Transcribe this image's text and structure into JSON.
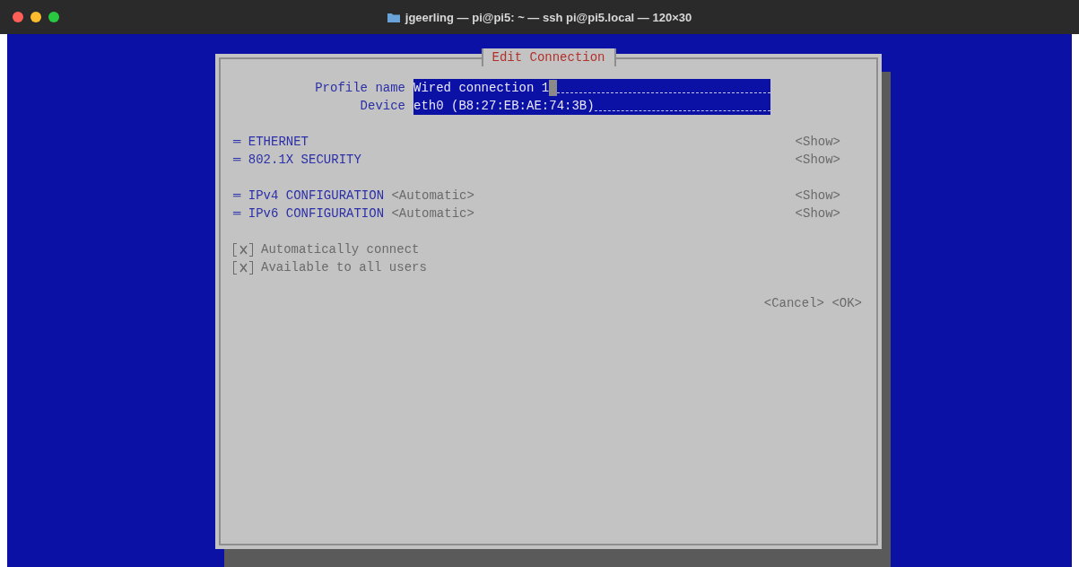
{
  "window": {
    "title": "jgeerling — pi@pi5: ~ — ssh pi@pi5.local — 120×30"
  },
  "dialog": {
    "title": "Edit Connection",
    "fields": [
      {
        "label": "Profile name",
        "value": "Wired connection 1",
        "focused": true
      },
      {
        "label": "Device",
        "value": "eth0 (B8:27:EB:AE:74:3B)",
        "focused": false
      }
    ],
    "section_groups": [
      [
        {
          "marker": "═",
          "title": "ETHERNET",
          "toggle": "<Show>"
        },
        {
          "marker": "═",
          "title": "802.1X SECURITY",
          "toggle": "<Show>"
        }
      ],
      [
        {
          "marker": "═",
          "title": "IPv4 CONFIGURATION",
          "value": "<Automatic>",
          "toggle": "<Show>"
        },
        {
          "marker": "═",
          "title": "IPv6 CONFIGURATION",
          "value": "<Automatic>",
          "toggle": "<Show>"
        }
      ]
    ],
    "checkboxes": [
      {
        "checked": true,
        "label": "Automatically connect"
      },
      {
        "checked": true,
        "label": "Available to all users"
      }
    ],
    "buttons": [
      "<Cancel>",
      "<OK>"
    ]
  }
}
